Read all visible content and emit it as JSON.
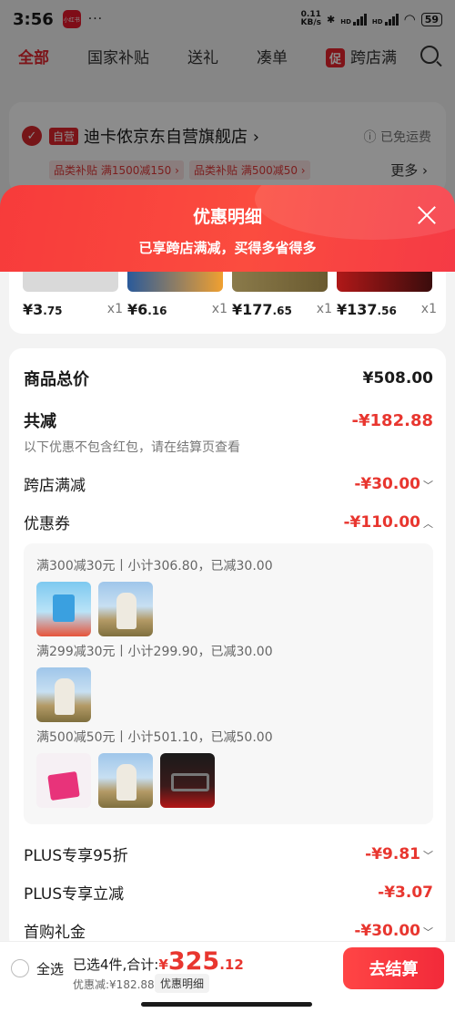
{
  "status": {
    "time": "3:56",
    "app_badge": "小红书",
    "speed": "0.11\nKB/s",
    "net1": "HD",
    "net2": "HD",
    "battery": "59"
  },
  "tabs": {
    "all": "全部",
    "subsidy": "国家补贴",
    "gift": "送礼",
    "bundle": "凑单",
    "promo_badge": "促",
    "cross": "跨店满"
  },
  "store": {
    "self_tag": "自营",
    "name": "迪卡侬京东自营旗舰店 ›",
    "free_ship": "ⓘ 已免运费",
    "promo1": "品类补贴 满1500减150 ›",
    "promo2": "品类补贴 满500减50 ›",
    "more": "更多 ›"
  },
  "sheet": {
    "title": "优惠明细",
    "subtitle": "已享跨店满减，买得多省得多"
  },
  "products": [
    {
      "price_int": "¥3",
      "price_dec": ".75",
      "qty": "x1"
    },
    {
      "price_int": "¥6",
      "price_dec": ".16",
      "qty": "x1"
    },
    {
      "price_int": "¥177",
      "price_dec": ".65",
      "qty": "x1"
    },
    {
      "price_int": "¥137",
      "price_dec": ".56",
      "qty": "x1"
    }
  ],
  "detail": {
    "total_label": "商品总价",
    "total_value": "¥508.00",
    "reduce_label": "共减",
    "reduce_value": "-¥182.88",
    "note": "以下优惠不包含红包，请在结算页查看",
    "cross_label": "跨店满减",
    "cross_value": "-¥30.00",
    "coupon_label": "优惠券",
    "coupon_value": "-¥110.00",
    "coupons": [
      {
        "text": "满300减30元丨小计306.80，已减30.00"
      },
      {
        "text": "满299减30元丨小计299.90，已减30.00"
      },
      {
        "text": "满500减50元丨小计501.10，已减50.00"
      }
    ],
    "plus95_label": "PLUS专享95折",
    "plus95_value": "-¥9.81",
    "plusnow_label": "PLUS专享立减",
    "plusnow_value": "-¥3.07",
    "first_label": "首购礼金",
    "first_value": "-¥30.00"
  },
  "bottom": {
    "select_all": "全选",
    "selected": "已选4件,合计:",
    "currency": "¥",
    "total_int": "325",
    "total_dec": ".12",
    "discount": "优惠减:¥182.88",
    "detail_btn": "优惠明细",
    "checkout": "去结算"
  },
  "colors": {
    "accent": "#e8362f",
    "brand_red": "#f73b3b"
  }
}
